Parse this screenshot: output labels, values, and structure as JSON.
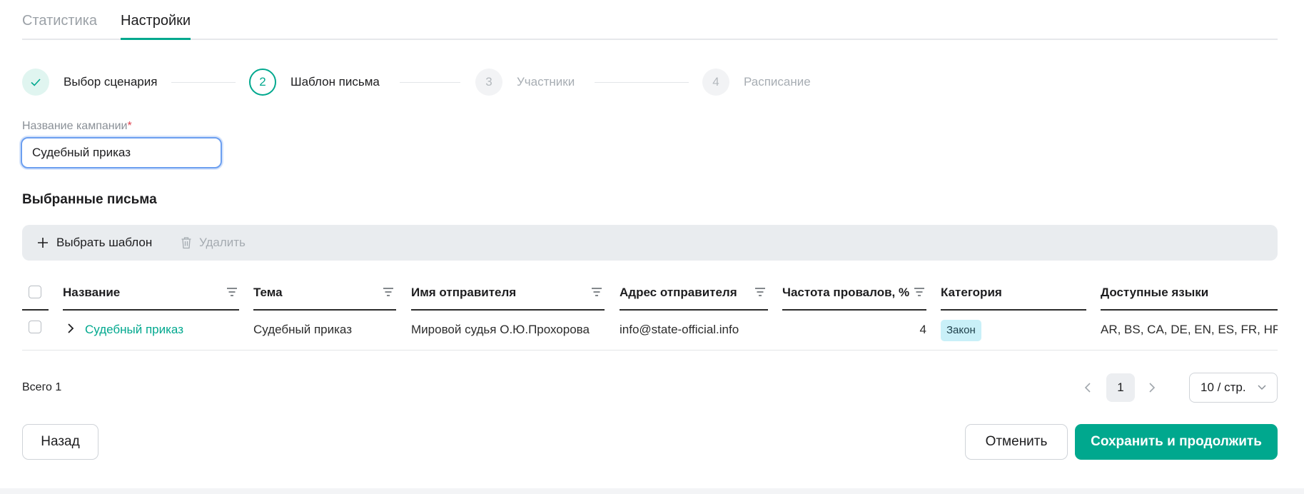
{
  "tabs": [
    {
      "label": "Статистика",
      "active": false
    },
    {
      "label": "Настройки",
      "active": true
    }
  ],
  "steps": [
    {
      "marker": "✓",
      "label": "Выбор сценария",
      "state": "done"
    },
    {
      "marker": "2",
      "label": "Шаблон письма",
      "state": "current"
    },
    {
      "marker": "3",
      "label": "Участники",
      "state": "todo"
    },
    {
      "marker": "4",
      "label": "Расписание",
      "state": "todo"
    }
  ],
  "campaign": {
    "label": "Название кампании",
    "required_mark": "*",
    "value": "Судебный приказ"
  },
  "section_title": "Выбранные письма",
  "toolbar": {
    "add_label": "Выбрать шаблон",
    "delete_label": "Удалить"
  },
  "table": {
    "columns": [
      "Название",
      "Тема",
      "Имя отправителя",
      "Адрес отправителя",
      "Частота провалов, %",
      "Категория",
      "Доступные языки"
    ],
    "rows": [
      {
        "name": "Судебный приказ",
        "subject": "Судебный приказ",
        "sender_name": "Мировой судья О.Ю.Прохорова",
        "sender_address": "info@state-official.info",
        "failure_rate": "4",
        "category": "Закон",
        "languages": "AR, BS, CA, DE, EN, ES, FR, HR, I..."
      }
    ]
  },
  "pagination": {
    "total": "Всего 1",
    "current_page": "1",
    "page_size": "10 / стр."
  },
  "buttons": {
    "back": "Назад",
    "cancel": "Отменить",
    "save": "Сохранить и продолжить"
  },
  "colors": {
    "accent": "#00a88e",
    "focus_border": "#6c9ff0",
    "badge_bg": "#c9f0f8",
    "toolbar_bg": "#e9ecef"
  },
  "icons": {
    "step_done": "check-icon",
    "add": "plus-icon",
    "delete": "trash-icon",
    "sort": "sort-icon",
    "expand": "chevron-right-icon",
    "prev": "chevron-left-icon",
    "next": "chevron-right-icon",
    "dropdown": "chevron-down-icon"
  }
}
